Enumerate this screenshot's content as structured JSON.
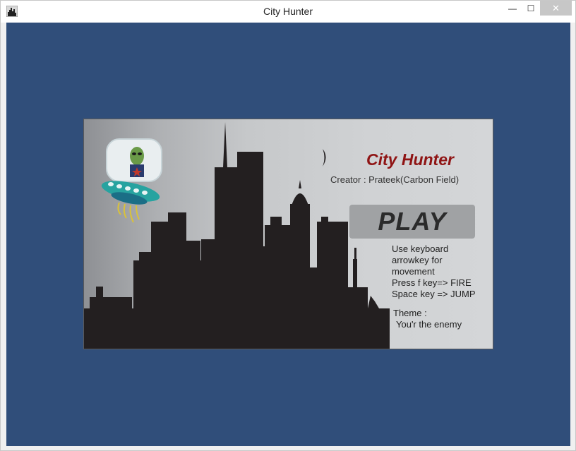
{
  "window": {
    "title": "City Hunter",
    "controls": {
      "minimize": "—",
      "maximize": "☐",
      "close": "✕"
    },
    "icons": {
      "app": "city-skyline-icon"
    }
  },
  "game": {
    "title": "City Hunter",
    "creator": "Creator : Prateek(Carbon Field)",
    "play_label": "PLAY",
    "instructions": [
      "Use keyboard",
      "arrowkey for",
      "movement",
      "Press f key=> FIRE",
      "Space key => JUMP"
    ],
    "theme": [
      "Theme :",
      "You'r the enemy"
    ],
    "colors": {
      "title": "#8f1414",
      "background": "#304e7a",
      "silhouette": "#231f20"
    }
  }
}
